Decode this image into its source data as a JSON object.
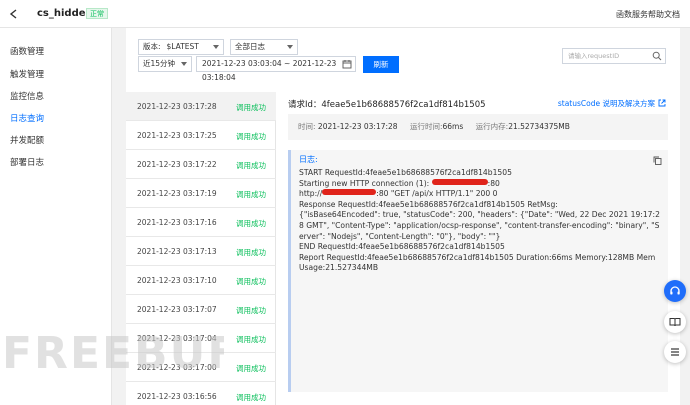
{
  "topbar": {
    "function_name": "cs_hidden",
    "status_tag": "正常",
    "help_link": "函数服务帮助文档"
  },
  "sidebar": {
    "items": [
      {
        "label": "函数管理",
        "active": false
      },
      {
        "label": "触发管理",
        "active": false
      },
      {
        "label": "监控信息",
        "active": false
      },
      {
        "label": "日志查询",
        "active": true
      },
      {
        "label": "并发配额",
        "active": false
      },
      {
        "label": "部署日志",
        "active": false
      }
    ]
  },
  "filters": {
    "version_label": "版本:",
    "version_value": "$LATEST",
    "log_type": "全部日志",
    "range": "近15分钟",
    "date_range": "2021-12-23 03:03:04 ~ 2021-12-23 03:18:04",
    "refresh_label": "刷新",
    "search_placeholder": "请输入requestID"
  },
  "log_list": [
    {
      "time": "2021-12-23 03:17:28",
      "status": "调用成功",
      "selected": true
    },
    {
      "time": "2021-12-23 03:17:25",
      "status": "调用成功"
    },
    {
      "time": "2021-12-23 03:17:22",
      "status": "调用成功"
    },
    {
      "time": "2021-12-23 03:17:19",
      "status": "调用成功"
    },
    {
      "time": "2021-12-23 03:17:16",
      "status": "调用成功"
    },
    {
      "time": "2021-12-23 03:17:13",
      "status": "调用成功"
    },
    {
      "time": "2021-12-23 03:17:10",
      "status": "调用成功"
    },
    {
      "time": "2021-12-23 03:17:07",
      "status": "调用成功"
    },
    {
      "time": "2021-12-23 03:17:04",
      "status": "调用成功"
    },
    {
      "time": "2021-12-23 03:17:00",
      "status": "调用成功"
    },
    {
      "time": "2021-12-23 03:16:56",
      "status": "调用成功"
    }
  ],
  "detail": {
    "request_id_label": "请求Id：4feae5e1b68688576f2ca1df814b1505",
    "status_code_link": "statusCode 说明及解决方案",
    "meta_time_label": "时间:",
    "meta_time": "2021-12-23 03:17:28",
    "meta_duration_label": "运行时间:",
    "meta_duration": "66ms",
    "meta_memory_label": "运行内存:",
    "meta_memory": "21.52734375MB",
    "log_title": "日志:",
    "log_lines": {
      "l1": "START RequestId:4feae5e1b68688576f2ca1df814b1505",
      "l2a": "Starting new HTTP connection (1): ",
      "l2b": ":80",
      "l3a": "http://",
      "l3b": ":80 \"GET /api/x HTTP/1.1\" 200 0",
      "l4": "Response RequestId:4feae5e1b68688576f2ca1df814b1505 RetMsg:",
      "l5": "{\"isBase64Encoded\": true, \"statusCode\": 200, \"headers\": {\"Date\": \"Wed, 22 Dec 2021 19:17:28 GMT\", \"Content-Type\": \"application/ocsp-response\", \"content-transfer-encoding\": \"binary\", \"Server\": \"Nodejs\", \"Content-Length\": \"0\"}, \"body\": \"\"}",
      "l6": "END RequestId:4feae5e1b68688576f2ca1df814b1505",
      "l7": "Report RequestId:4feae5e1b68688576f2ca1df814b1505 Duration:66ms Memory:128MB MemUsage:21.527344MB"
    }
  },
  "colors": {
    "accent": "#006eff",
    "success": "#0abf5b",
    "redaction": "#e0241b"
  },
  "watermark": "FREEBUF"
}
